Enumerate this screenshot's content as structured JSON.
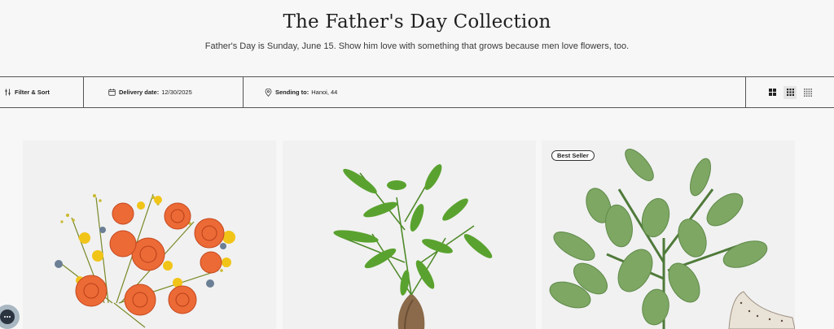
{
  "hero": {
    "title": "The Father's Day Collection",
    "subtitle": "Father's Day is Sunday, June 15. Show him love with something that grows because men love flowers, too."
  },
  "toolbar": {
    "filter_label": "Filter & Sort",
    "delivery_label": "Delivery date:",
    "delivery_value": "12/30/2025",
    "sending_label": "Sending to:",
    "sending_value": "Hanoi, 44",
    "grid_options": [
      "grid-large-icon",
      "grid-medium-icon",
      "grid-small-icon"
    ],
    "active_grid": "grid-medium-icon"
  },
  "products": [
    {
      "image": "orange-rose-bouquet",
      "badge": ""
    },
    {
      "image": "money-tree-plant",
      "badge": ""
    },
    {
      "image": "jade-succulent-plant",
      "badge": "Best Seller"
    }
  ],
  "colors": {
    "background": "#f7f7f7",
    "card_background": "#f1f1f1",
    "border": "#555555",
    "chat_button": "#a9b7c2"
  }
}
